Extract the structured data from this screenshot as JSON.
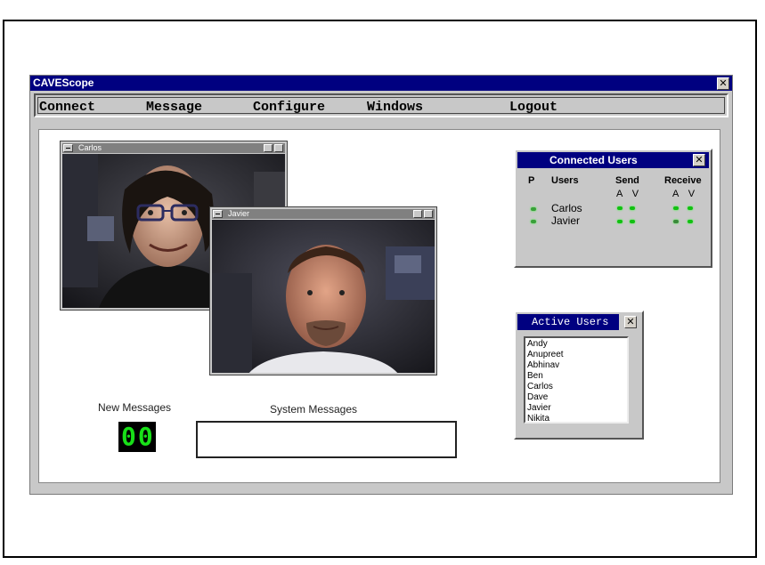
{
  "window": {
    "title": "CAVEScope",
    "close_glyph": "✕"
  },
  "menu": {
    "items": [
      {
        "label": "Connect"
      },
      {
        "label": "Message"
      },
      {
        "label": "Configure"
      },
      {
        "label": "Windows"
      },
      {
        "label": "Logout"
      }
    ]
  },
  "video_windows": [
    {
      "name": "Carlos"
    },
    {
      "name": "Javier"
    }
  ],
  "connected_users": {
    "title": "Connected Users",
    "close_glyph": "✕",
    "headers": {
      "p": "P",
      "users": "Users",
      "send": "Send",
      "receive": "Receive"
    },
    "send_sub": "A V",
    "receive_sub": "A V",
    "rows": [
      {
        "name": "Carlos"
      },
      {
        "name": "Javier"
      }
    ],
    "led_color": "#12c012"
  },
  "active_users": {
    "title": "Active Users",
    "close_glyph": "✕",
    "items": [
      "Andy",
      "Anupreet",
      "Abhinav",
      "Ben",
      "Carlos",
      "Dave",
      "Javier",
      "Nikita"
    ]
  },
  "new_messages": {
    "label": "New Messages",
    "count": "00",
    "digit_color": "#18e018"
  },
  "system_messages": {
    "label": "System  Messages",
    "value": ""
  },
  "colors": {
    "titlebar": "#000080",
    "face": "#c8c8c8"
  }
}
